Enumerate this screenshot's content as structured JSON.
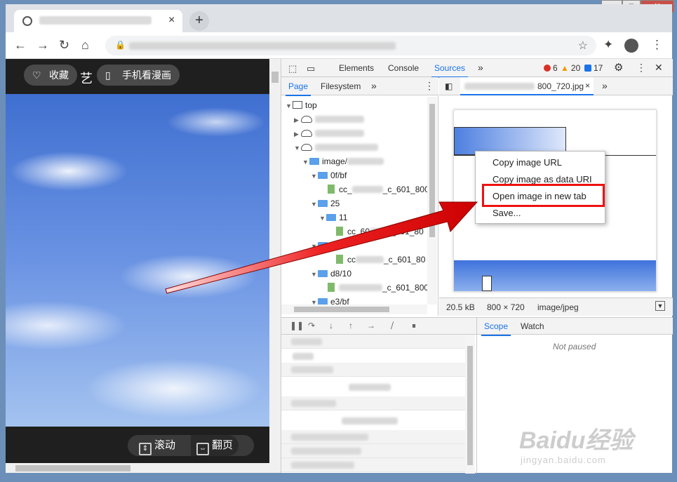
{
  "window": {
    "minimize": "–",
    "maximize": "□",
    "close": "✕"
  },
  "browser": {
    "new_tab": "+",
    "tab_close": "×"
  },
  "page": {
    "favorite_label": "收藏",
    "title_char": "艺",
    "mobile_label": "手机看漫画",
    "scroll_label": "滚动",
    "flip_label": "翻页"
  },
  "devtools": {
    "tabs": [
      "Elements",
      "Console",
      "Sources"
    ],
    "active_tab": "Sources",
    "more": "»",
    "errors": "6",
    "warnings": "20",
    "messages": "17",
    "nav_tabs": [
      "Page",
      "Filesystem"
    ],
    "tree": {
      "top": "top",
      "image_folder": "image/",
      "f1": "0f/bf",
      "file1_a": "cc_",
      "file1_b": "_c_601_800_",
      "f2": "25",
      "f3": "11",
      "file2_a": "cc_60",
      "file2_b": "c_601_80",
      "f4_tail": "8",
      "file3_a": "cc",
      "file3_b": "_c_601_80",
      "f5": "d8/10",
      "file4_b": "_c_601_800_",
      "f6": "e3/bf"
    },
    "editor_tab": "800_720.jpg",
    "image_size": "20.5 kB",
    "image_dims": "800 × 720",
    "image_type": "image/jpeg",
    "context_menu": [
      "Copy image URL",
      "Copy image as data URI",
      "Open image in new tab",
      "Save..."
    ],
    "scope_tabs": [
      "Scope",
      "Watch"
    ],
    "not_paused": "Not paused"
  },
  "watermark": {
    "brand": "Baidu经验",
    "domain": "jingyan.baidu.com"
  },
  "colors": {
    "accent": "#1a73e8",
    "highlight": "#e11111",
    "arrow": "#e00000"
  }
}
